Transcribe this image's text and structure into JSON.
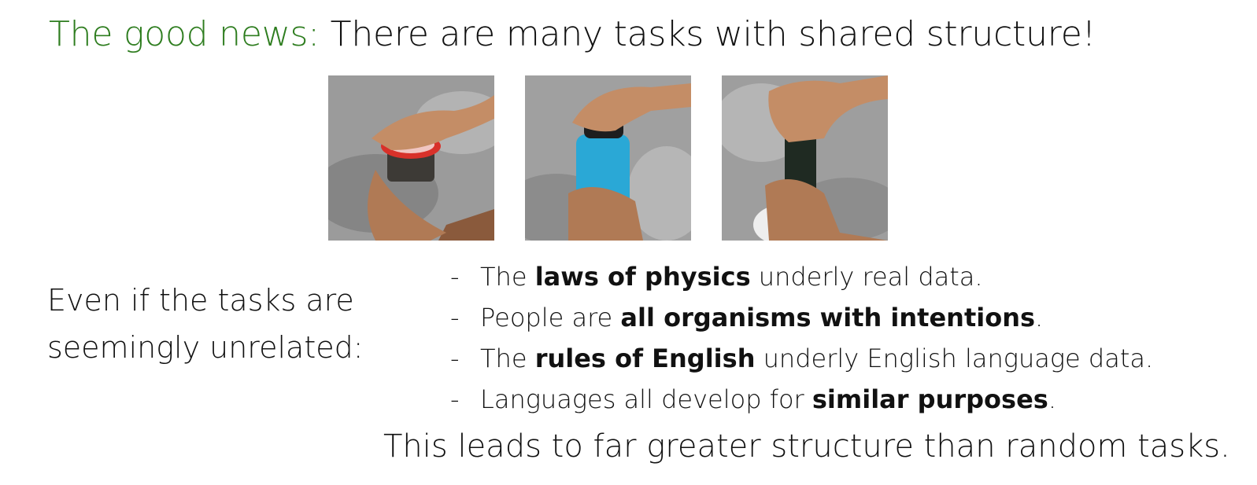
{
  "title": {
    "lead": "The good news:",
    "rest": "There are many tasks with shared structure!"
  },
  "images": [
    {
      "subject": "hand opening jar with checkered lid"
    },
    {
      "subject": "hand opening blue water bottle"
    },
    {
      "subject": "hand twisting spice grinder"
    }
  ],
  "side_text": {
    "line1": "Even if the tasks are",
    "line2": "seemingly unrelated:"
  },
  "bullets": [
    {
      "dash": "-",
      "pre": "The ",
      "bold": "laws of physics",
      "post": " underly real data."
    },
    {
      "dash": "-",
      "pre": "People are ",
      "bold": "all organisms with intentions",
      "post": "."
    },
    {
      "dash": "-",
      "pre": "The ",
      "bold": "rules of English",
      "post": " underly English language data."
    },
    {
      "dash": "-",
      "pre": "Languages all develop for ",
      "bold": "similar purposes",
      "post": "."
    }
  ],
  "conclusion": "This leads to far greater structure than random tasks.",
  "colors": {
    "accent_green": "#2e7d1f",
    "text": "#111111"
  }
}
